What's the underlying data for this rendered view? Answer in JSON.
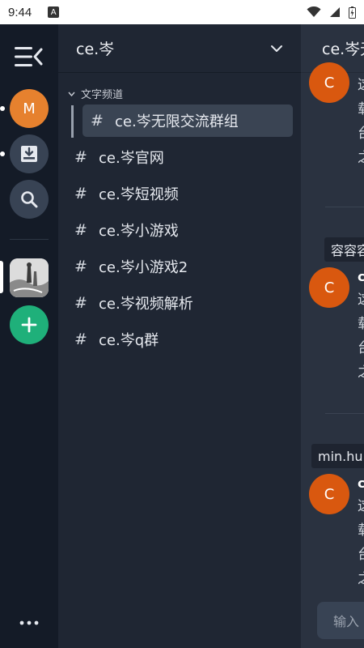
{
  "status_bar": {
    "time": "9:44",
    "notif_badge": "A"
  },
  "rail": {
    "user_avatar_letter": "M",
    "user_avatar_color": "#e6812e",
    "add_server_color": "#1fb07a"
  },
  "server": {
    "name": "ce.岑",
    "category": "文字频道",
    "channels": [
      "ce.岑无限交流群组",
      "ce.岑官网",
      "ce.岑短视频",
      "ce.岑小游戏",
      "ce.岑小游戏2",
      "ce.岑视频解析",
      "ce.岑q群"
    ],
    "hash": "#"
  },
  "chat": {
    "title": "ce.岑无",
    "avatar_letter": "C",
    "avatar_color": "#d9580f",
    "messages": [
      {
        "author": "",
        "lines": [
          "这",
          "载",
          "台",
          "之"
        ]
      },
      {
        "quote": "容容容",
        "author": "c",
        "lines": [
          "这",
          "载",
          "台",
          "之"
        ]
      },
      {
        "quote": "min.hu",
        "author": "c",
        "lines": [
          "这",
          "载",
          "台",
          "之"
        ]
      }
    ],
    "input_placeholder": "输入"
  }
}
